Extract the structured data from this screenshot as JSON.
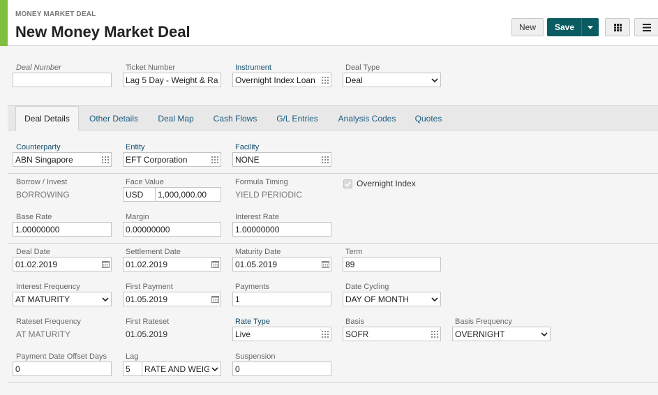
{
  "header": {
    "subtitle": "MONEY MARKET DEAL",
    "title": "New Money Market Deal",
    "new_label": "New",
    "save_label": "Save",
    "accent_color": "#7fbf3f",
    "save_color": "#0b5c60"
  },
  "top_fields": {
    "deal_number": {
      "label": "Deal Number",
      "value": ""
    },
    "ticket_number": {
      "label": "Ticket Number",
      "value": "Lag 5 Day - Weight & Ra"
    },
    "instrument": {
      "label": "Instrument",
      "value": "Overnight Index Loan"
    },
    "deal_type": {
      "label": "Deal Type",
      "value": "Deal"
    }
  },
  "tabs": [
    "Deal Details",
    "Other Details",
    "Deal Map",
    "Cash Flows",
    "G/L Entries",
    "Analysis Codes",
    "Quotes"
  ],
  "details": {
    "counterparty": {
      "label": "Counterparty",
      "value": "ABN Singapore"
    },
    "entity": {
      "label": "Entity",
      "value": "EFT Corporation"
    },
    "facility": {
      "label": "Facility",
      "value": "NONE"
    },
    "borrow_invest": {
      "label": "Borrow / Invest",
      "value": "BORROWING"
    },
    "face_value": {
      "label": "Face Value",
      "currency": "USD",
      "value": "1,000,000.00"
    },
    "formula_timing": {
      "label": "Formula Timing",
      "value": "YIELD PERIODIC"
    },
    "overnight_index": {
      "label": "Overnight Index",
      "checked": true
    },
    "base_rate": {
      "label": "Base Rate",
      "value": "1.00000000"
    },
    "margin": {
      "label": "Margin",
      "value": "0.00000000"
    },
    "interest_rate": {
      "label": "Interest Rate",
      "value": "1.00000000"
    },
    "deal_date": {
      "label": "Deal Date",
      "value": "01.02.2019"
    },
    "settlement_date": {
      "label": "Settlement Date",
      "value": "01.02.2019"
    },
    "maturity_date": {
      "label": "Maturity Date",
      "value": "01.05.2019"
    },
    "term": {
      "label": "Term",
      "value": "89"
    },
    "interest_frequency": {
      "label": "Interest Frequency",
      "value": "AT MATURITY"
    },
    "first_payment": {
      "label": "First Payment",
      "value": "01.05.2019"
    },
    "payments": {
      "label": "Payments",
      "value": "1"
    },
    "date_cycling": {
      "label": "Date Cycling",
      "value": "DAY OF MONTH"
    },
    "rateset_frequency": {
      "label": "Rateset Frequency",
      "value": "AT MATURITY"
    },
    "first_rateset": {
      "label": "First Rateset",
      "value": "01.05.2019"
    },
    "rate_type": {
      "label": "Rate Type",
      "value": "Live"
    },
    "basis": {
      "label": "Basis",
      "value": "SOFR"
    },
    "basis_frequency": {
      "label": "Basis Frequency",
      "value": "OVERNIGHT"
    },
    "payment_date_offset_days": {
      "label": "Payment Date Offset Days",
      "value": "0"
    },
    "lag": {
      "label": "Lag",
      "days": "5",
      "method": "RATE AND WEIGHT"
    },
    "suspension": {
      "label": "Suspension",
      "value": "0"
    }
  }
}
